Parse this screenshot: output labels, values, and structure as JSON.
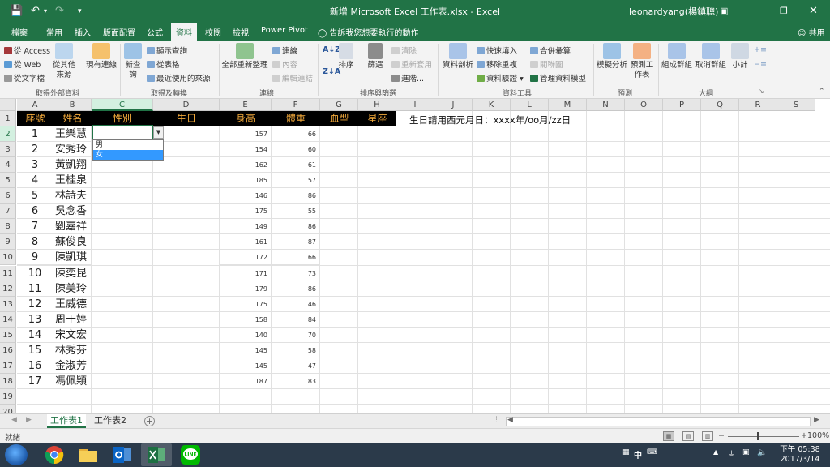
{
  "window": {
    "title": "新增 Microsoft Excel 工作表.xlsx - Excel",
    "user": "leonardyang(楊鎮聰)"
  },
  "ribbon_tabs": [
    "檔案",
    "常用",
    "插入",
    "版面配置",
    "公式",
    "資料",
    "校閱",
    "檢視",
    "Power Pivot"
  ],
  "active_tab": "資料",
  "tell_me": "告訴我您想要執行的動作",
  "share": "共用",
  "ribbon": {
    "get_external": {
      "access": "從 Access",
      "web": "從 Web",
      "text": "從文字檔",
      "other": "從其他來源",
      "existing": "現有連線",
      "label": "取得外部資料"
    },
    "get_transform": {
      "new_query": "新查詢",
      "show_queries": "顯示查詢",
      "from_table": "從表格",
      "recent": "最近使用的來源",
      "label": "取得及轉換"
    },
    "connections": {
      "refresh_all": "全部重新整理",
      "connections": "連線",
      "properties": "內容",
      "edit_links": "編輯連結",
      "label": "連線"
    },
    "sort_filter": {
      "sort": "排序",
      "filter": "篩選",
      "clear": "清除",
      "reapply": "重新套用",
      "advanced": "進階...",
      "label": "排序與篩選"
    },
    "data_tools": {
      "text_to_columns": "資料剖析",
      "flash_fill": "快速填入",
      "remove_dup": "移除重複",
      "validation": "資料驗證",
      "consolidate": "合併彙算",
      "relationships": "關聯圖",
      "data_model": "管理資料模型",
      "label": "資料工具"
    },
    "forecast": {
      "what_if": "模擬分析",
      "forecast_sheet": "預測工作表",
      "label": "預測"
    },
    "outline": {
      "group": "組成群組",
      "ungroup": "取消群組",
      "subtotal": "小計",
      "label": "大綱"
    }
  },
  "columns": [
    "A",
    "B",
    "C",
    "D",
    "E",
    "F",
    "G",
    "H",
    "I",
    "J",
    "K",
    "L",
    "M",
    "N",
    "O",
    "P",
    "Q",
    "R",
    "S"
  ],
  "rows": [
    "1",
    "2",
    "3",
    "4",
    "5",
    "6",
    "7",
    "8",
    "9",
    "10",
    "11",
    "12",
    "13",
    "14",
    "15",
    "16",
    "17",
    "18",
    "19",
    "20"
  ],
  "headers": [
    "座號",
    "姓名",
    "性別",
    "生日",
    "身高",
    "體重",
    "血型",
    "星座"
  ],
  "note": "生日請用西元月日：xxxx年/oo月/zz日",
  "students": [
    {
      "seat": "1",
      "name": "王樂慧",
      "height": "157",
      "weight": "66"
    },
    {
      "seat": "2",
      "name": "安秀玲",
      "height": "154",
      "weight": "60"
    },
    {
      "seat": "3",
      "name": "黃凱翔",
      "height": "162",
      "weight": "61"
    },
    {
      "seat": "4",
      "name": "王桂泉",
      "height": "185",
      "weight": "57"
    },
    {
      "seat": "5",
      "name": "林詩夫",
      "height": "146",
      "weight": "86"
    },
    {
      "seat": "6",
      "name": "吳念香",
      "height": "175",
      "weight": "55"
    },
    {
      "seat": "7",
      "name": "劉嘉祥",
      "height": "149",
      "weight": "86"
    },
    {
      "seat": "8",
      "name": "蘇俊良",
      "height": "161",
      "weight": "87"
    },
    {
      "seat": "9",
      "name": "陳凱琪",
      "height": "172",
      "weight": "66"
    },
    {
      "seat": "10",
      "name": "陳奕昆",
      "height": "171",
      "weight": "73"
    },
    {
      "seat": "11",
      "name": "陳美玲",
      "height": "179",
      "weight": "86"
    },
    {
      "seat": "12",
      "name": "王威德",
      "height": "175",
      "weight": "46"
    },
    {
      "seat": "13",
      "name": "周于婷",
      "height": "158",
      "weight": "84"
    },
    {
      "seat": "14",
      "name": "宋文宏",
      "height": "140",
      "weight": "70"
    },
    {
      "seat": "15",
      "name": "林秀芬",
      "height": "145",
      "weight": "58"
    },
    {
      "seat": "16",
      "name": "金淑芳",
      "height": "145",
      "weight": "47"
    },
    {
      "seat": "17",
      "name": "馮佩穎",
      "height": "187",
      "weight": "83"
    }
  ],
  "dropdown": {
    "options": [
      "男",
      "女"
    ],
    "highlighted": "女"
  },
  "sheets": [
    "工作表1",
    "工作表2"
  ],
  "active_sheet": "工作表1",
  "status": {
    "ready": "就緒",
    "zoom": "100%"
  },
  "taskbar": {
    "apps": [
      "chrome",
      "file-explorer",
      "outlook",
      "excel",
      "line"
    ],
    "ime": "中",
    "time": "下午 05:38",
    "date": "2017/3/14"
  },
  "colors": {
    "excel_green": "#217346",
    "header_bg": "#000000",
    "header_text": "#f2a93b",
    "highlight": "#3399ff"
  }
}
